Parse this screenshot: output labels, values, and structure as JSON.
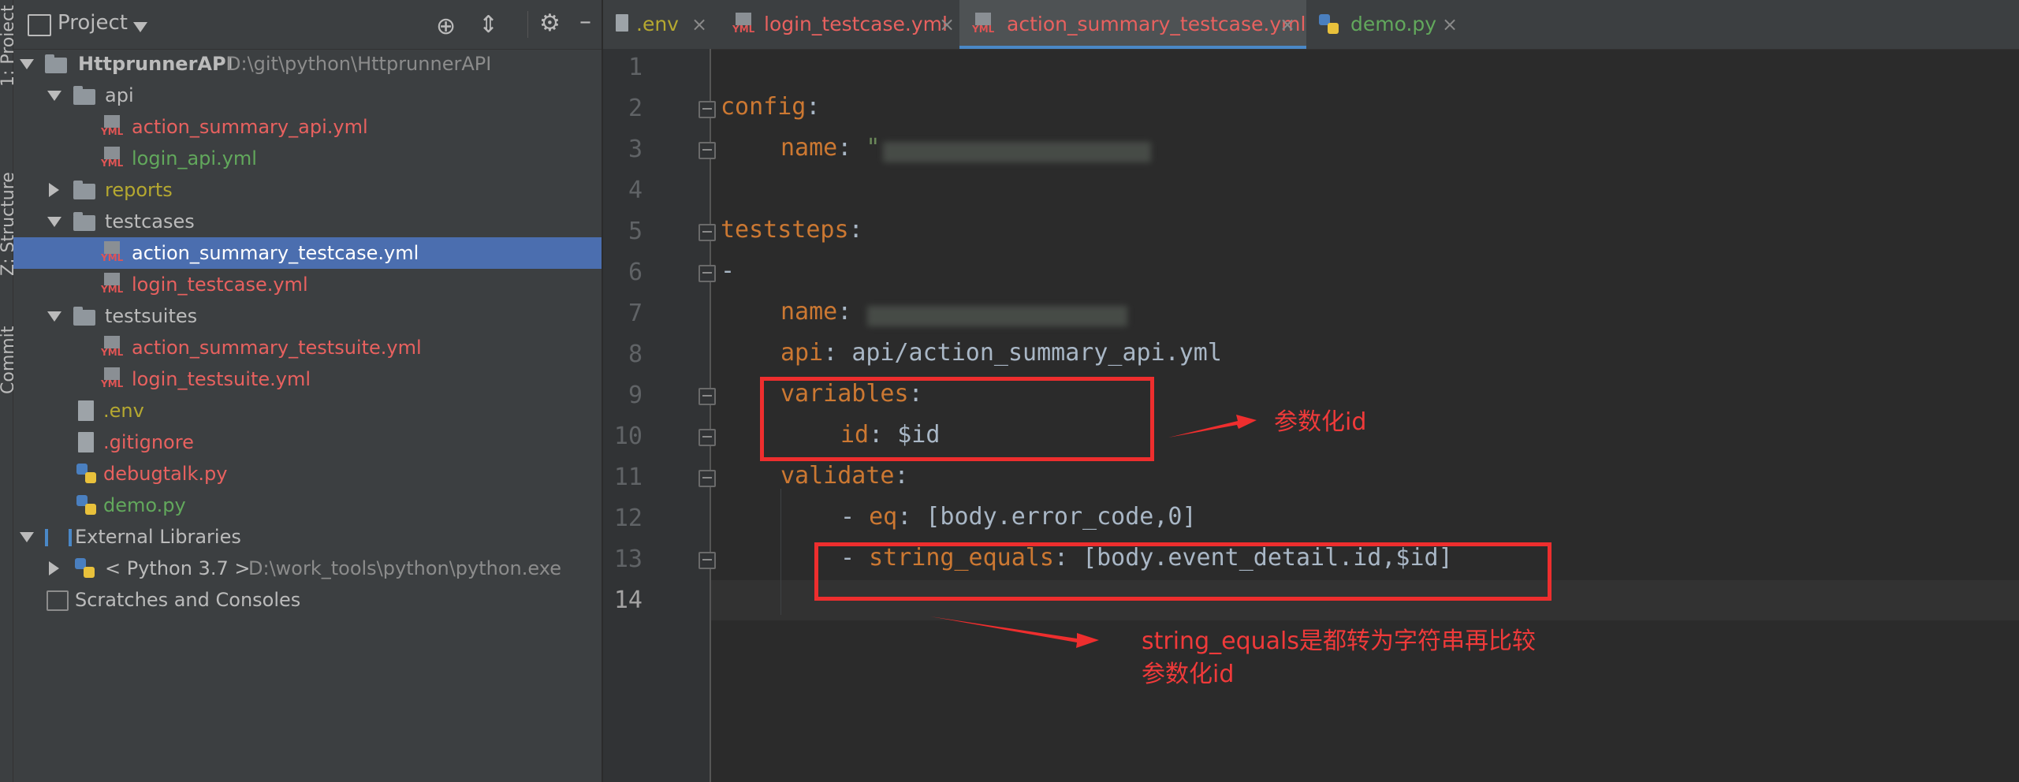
{
  "stripe": {
    "tabs": [
      {
        "label": "1: Project"
      },
      {
        "label": "Z: Structure"
      },
      {
        "label": "Commit"
      }
    ]
  },
  "project_panel": {
    "title": "Project",
    "root": {
      "name": "HttprunnerAPI",
      "path": "D:\\git\\python\\HttprunnerAPI"
    },
    "tree": [
      {
        "label": "api"
      },
      {
        "label": "action_summary_api.yml"
      },
      {
        "label": "login_api.yml"
      },
      {
        "label": "reports"
      },
      {
        "label": "testcases"
      },
      {
        "label": "action_summary_testcase.yml"
      },
      {
        "label": "login_testcase.yml"
      },
      {
        "label": "testsuites"
      },
      {
        "label": "action_summary_testsuite.yml"
      },
      {
        "label": "login_testsuite.yml"
      },
      {
        "label": ".env"
      },
      {
        "label": ".gitignore"
      },
      {
        "label": "debugtalk.py"
      },
      {
        "label": "demo.py"
      },
      {
        "label": "External Libraries"
      },
      {
        "label": "< Python 3.7 >",
        "path": "D:\\work_tools\\python\\python.exe"
      },
      {
        "label": "Scratches and Consoles"
      }
    ]
  },
  "tabs": [
    {
      "label": ".env",
      "close": "×"
    },
    {
      "label": "login_testcase.yml",
      "close": "×"
    },
    {
      "label": "action_summary_testcase.yml",
      "close": "×",
      "active": true
    },
    {
      "label": "demo.py",
      "close": "×"
    }
  ],
  "editor": {
    "line_numbers": [
      "1",
      "2",
      "3",
      "4",
      "5",
      "6",
      "7",
      "8",
      "9",
      "10",
      "11",
      "12",
      "13",
      "14"
    ],
    "lines": {
      "l2_key": "config",
      "l3_key": "name",
      "l3_val": "\"",
      "l5_key": "teststeps",
      "l6": "-",
      "l7_key": "name",
      "l8_key": "api",
      "l8_val": "api/action_summary_api.yml",
      "l9_key": "variables",
      "l10_key": "id",
      "l10_val": "$id",
      "l11_key": "validate",
      "l12_dash": "- ",
      "l12_key": "eq",
      "l12_val": "[body.error_code,0]",
      "l13_dash": "- ",
      "l13_key": "string_equals",
      "l13_val": "[body.event_detail.id,$id]"
    }
  },
  "annotations": {
    "note1": "参数化id",
    "note2_line1": "string_equals是都转为字符串再比较",
    "note2_line2": "参数化id"
  },
  "colors": {
    "keyword": "#cc7832",
    "annotation_red": "#ee2e2e",
    "selection": "#4b6eaf"
  }
}
